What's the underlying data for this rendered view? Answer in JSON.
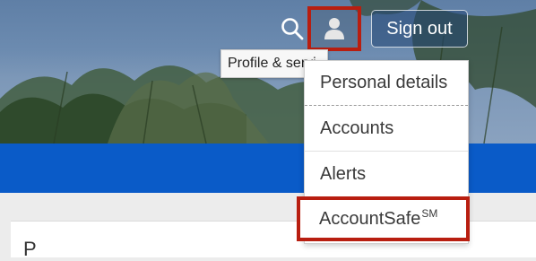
{
  "header": {
    "search_icon": "search-icon",
    "profile_icon": "user-icon",
    "signout_label": "Sign out",
    "tooltip_text": "Profile & servi"
  },
  "menu": {
    "items": [
      {
        "label": "Personal details"
      },
      {
        "label": "Accounts"
      },
      {
        "label": "Alerts"
      },
      {
        "label": "AccountSafe",
        "superscript": "SM"
      }
    ]
  },
  "content": {
    "heading_partial": "P"
  },
  "colors": {
    "highlight": "#b81e10",
    "band": "#0a5bc8",
    "menu_text": "#3a3a3a"
  }
}
